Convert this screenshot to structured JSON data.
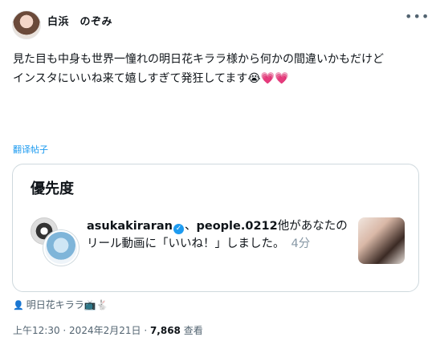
{
  "header": {
    "display_name": "白浜　のぞみ",
    "more_icon": "more-horizontal-icon"
  },
  "tweet": {
    "text_line1": "見た目も中身も世界一憧れの明日花キララ様から何かの間違いかもだけど",
    "text_line2": "インスタにいいね来て嬉しすぎて発狂してます😭💗💗"
  },
  "translate_label": "翻译帖子",
  "card": {
    "title": "優先度",
    "notification": {
      "user1": "asukakiraran",
      "separator": "、",
      "user2": "people.0212",
      "message": "他があなたのリール動画に「いいね！」しました。",
      "time": "4分"
    }
  },
  "tagged": {
    "icon": "person-icon",
    "label": "明日花キララ📺🐇"
  },
  "meta": {
    "time": "上午12:30",
    "dot": " · ",
    "date": "2024年2月21日",
    "views_count": "7,868",
    "views_label": " 查看"
  },
  "colors": {
    "link": "#1d9bf0",
    "secondary_text": "#536471",
    "border": "#cfd9de"
  }
}
